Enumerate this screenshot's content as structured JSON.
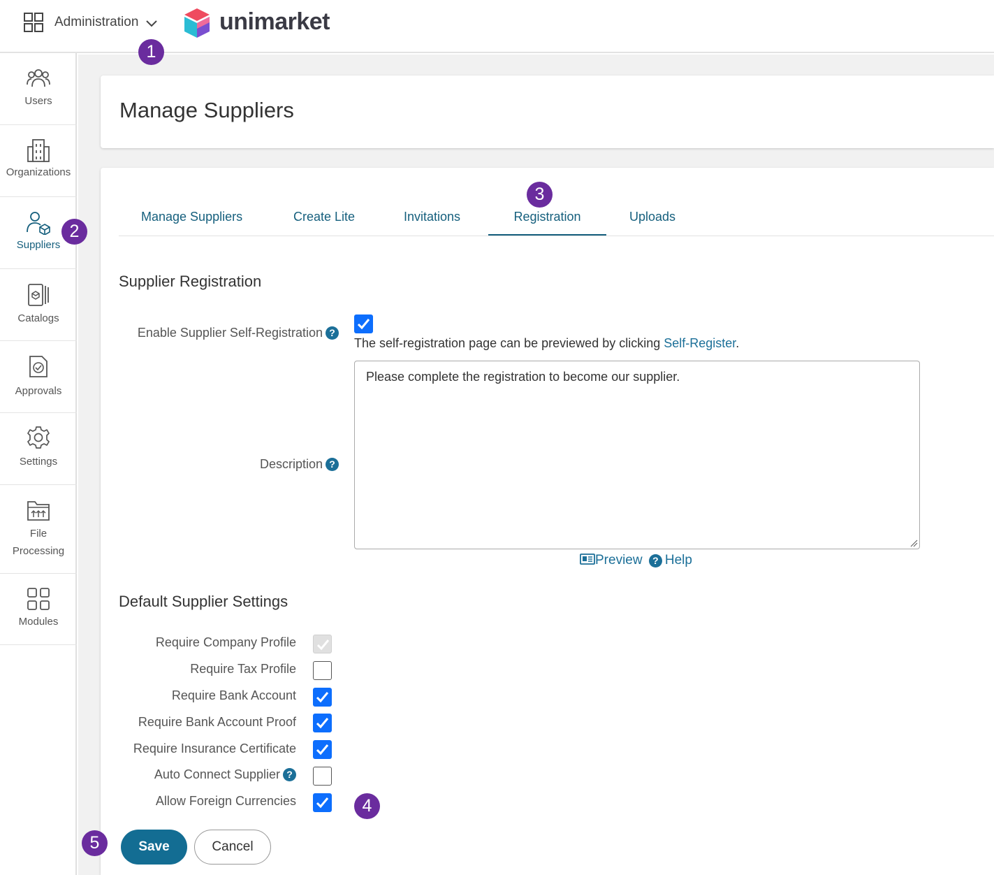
{
  "header": {
    "app_switcher_label": "Administration",
    "logo_text": "unimarket"
  },
  "sidebar": {
    "items": [
      {
        "label": "Users",
        "icon": "users-icon"
      },
      {
        "label": "Organizations",
        "icon": "building-icon"
      },
      {
        "label": "Suppliers",
        "icon": "supplier-icon"
      },
      {
        "label": "Catalogs",
        "icon": "catalog-icon"
      },
      {
        "label": "Approvals",
        "icon": "approval-icon"
      },
      {
        "label": "Settings",
        "icon": "gear-icon"
      },
      {
        "label_line1": "File",
        "label_line2": "Processing",
        "icon": "folder-upload-icon"
      },
      {
        "label": "Modules",
        "icon": "modules-icon"
      }
    ]
  },
  "page": {
    "title": "Manage Suppliers"
  },
  "tabs": [
    {
      "label": "Manage Suppliers"
    },
    {
      "label": "Create Lite"
    },
    {
      "label": "Invitations"
    },
    {
      "label": "Registration",
      "active": true
    },
    {
      "label": "Uploads"
    }
  ],
  "registration": {
    "heading": "Supplier Registration",
    "enable_label": "Enable Supplier Self-Registration",
    "enable_checked": true,
    "preview_text": "The self-registration page can be previewed by clicking ",
    "preview_link": "Self-Register",
    "preview_suffix": ".",
    "description_label": "Description",
    "description_value": "Please complete the registration to become our supplier.",
    "preview_button": "Preview",
    "help_button": "Help"
  },
  "defaults": {
    "heading": "Default Supplier Settings",
    "settings": [
      {
        "label": "Require Company Profile",
        "state": "disabled-checked"
      },
      {
        "label": "Require Tax Profile",
        "state": "unchecked"
      },
      {
        "label": "Require Bank Account",
        "state": "checked"
      },
      {
        "label": "Require Bank Account Proof",
        "state": "checked"
      },
      {
        "label": "Require Insurance Certificate",
        "state": "checked"
      },
      {
        "label": "Auto Connect Supplier",
        "state": "unchecked",
        "help": true
      },
      {
        "label": "Allow Foreign Currencies",
        "state": "checked"
      }
    ]
  },
  "actions": {
    "save_label": "Save",
    "cancel_label": "Cancel"
  },
  "badges": [
    "1",
    "2",
    "3",
    "4",
    "5"
  ],
  "colors": {
    "accent": "#155f7d",
    "checkbox": "#0d6efd",
    "badge": "#6a2c9e",
    "save_button": "#136d93"
  }
}
